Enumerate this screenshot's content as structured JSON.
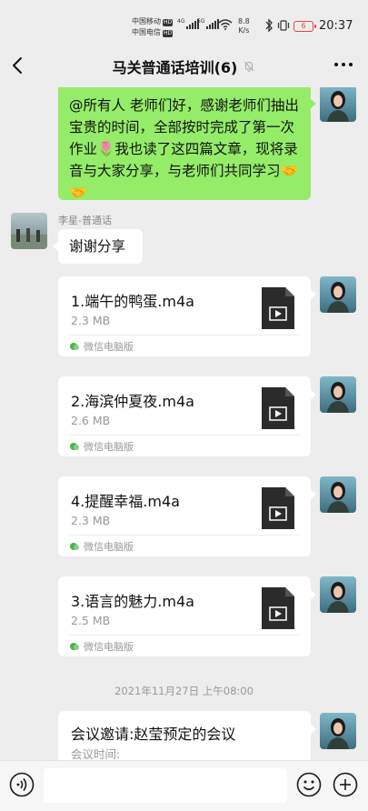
{
  "status_bar": {
    "carrier1": "中国移动",
    "carrier2": "中国电信",
    "hd": "HD",
    "net1": "4G",
    "net2": "5G",
    "speed_value": "8.8",
    "speed_unit": "K/s",
    "battery": "6",
    "time": "20:37"
  },
  "header": {
    "title": "马关普通话培训(6)",
    "back_icon": "chevron-left-icon",
    "mute_icon": "bell-off-icon",
    "more_icon": "more-dots-icon"
  },
  "messages": {
    "announcement": {
      "text": "@所有人  老师们好，感谢老师们抽出宝贵的时间，全部按时完成了第一次作业🌷我也读了这四篇文章，现将录音与大家分享，与老师们共同学习🤝🤝"
    },
    "reply": {
      "sender": "李星-普通话",
      "text": "谢谢分享"
    },
    "files": [
      {
        "name": "1.端午的鸭蛋.m4a",
        "size": "2.3 MB",
        "source": "微信电脑版"
      },
      {
        "name": "2.海滨仲夏夜.m4a",
        "size": "2.6 MB",
        "source": "微信电脑版"
      },
      {
        "name": "4.提醒幸福.m4a",
        "size": "2.3 MB",
        "source": "微信电脑版"
      },
      {
        "name": "3.语言的魅力.m4a",
        "size": "2.5 MB",
        "source": "微信电脑版"
      }
    ],
    "timestamp": "2021年11月27日 上午08:00",
    "meeting": {
      "title": "会议邀请:赵莹预定的会议",
      "subtitle": "会议时间:"
    }
  },
  "input_bar": {
    "placeholder": "",
    "voice_icon": "voice-icon",
    "emoji_icon": "emoji-icon",
    "plus_icon": "plus-icon"
  },
  "colors": {
    "background": "#ededed",
    "sent_bubble": "#95ec69",
    "received_bubble": "#ffffff",
    "file_icon": "#2b2b2b"
  }
}
